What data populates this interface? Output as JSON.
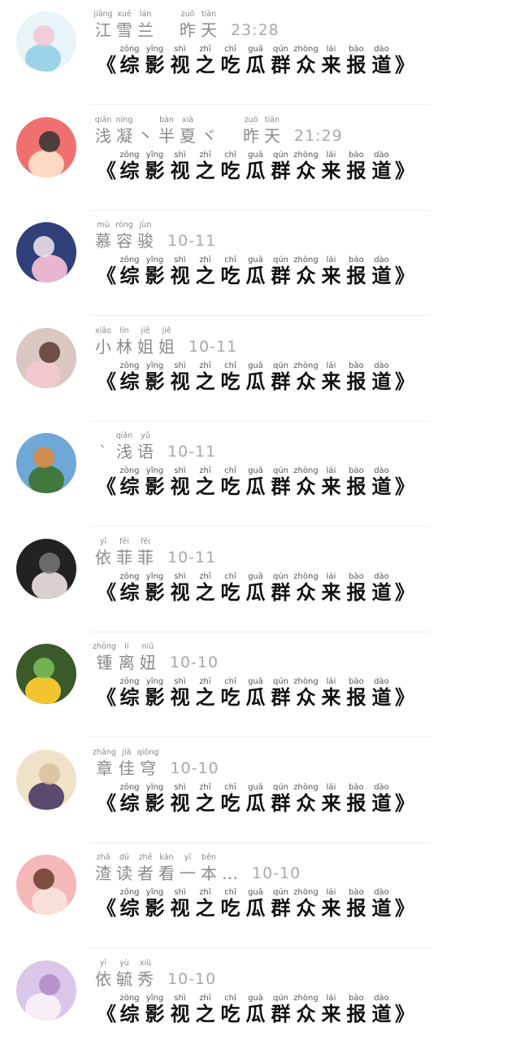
{
  "message": {
    "chars": [
      {
        "hz": "《",
        "py": ""
      },
      {
        "hz": "综",
        "py": "zōng"
      },
      {
        "hz": "影",
        "py": "yǐng"
      },
      {
        "hz": "视",
        "py": "shì"
      },
      {
        "hz": "之",
        "py": "zhī"
      },
      {
        "hz": "吃",
        "py": "chī"
      },
      {
        "hz": "瓜",
        "py": "guā"
      },
      {
        "hz": "群",
        "py": "qún"
      },
      {
        "hz": "众",
        "py": "zhòng"
      },
      {
        "hz": "来",
        "py": "lái"
      },
      {
        "hz": "报",
        "py": "bào"
      },
      {
        "hz": "道",
        "py": "dào"
      },
      {
        "hz": "》",
        "py": ""
      }
    ]
  },
  "contacts": [
    {
      "name": [
        {
          "hz": "江",
          "py": "jiāng"
        },
        {
          "hz": "雪",
          "py": "xuě"
        },
        {
          "hz": "兰",
          "py": "lán"
        },
        {
          "hz": " ",
          "py": ""
        },
        {
          "hz": "昨",
          "py": "zuó"
        },
        {
          "hz": "天",
          "py": "tiān"
        }
      ],
      "time": "23:28",
      "avatar_colors": [
        "#e8f4f8",
        "#9cd3e6",
        "#f2c6d4"
      ]
    },
    {
      "name": [
        {
          "hz": "浅",
          "py": "qiǎn"
        },
        {
          "hz": "凝",
          "py": "níng"
        },
        {
          "hz": "丶",
          "py": ""
        },
        {
          "hz": "半",
          "py": "bàn"
        },
        {
          "hz": "夏",
          "py": "xià"
        },
        {
          "hz": "ヾ",
          "py": ""
        },
        {
          "hz": " ",
          "py": ""
        },
        {
          "hz": "昨",
          "py": "zuó"
        },
        {
          "hz": "天",
          "py": "tiān"
        }
      ],
      "time": "21:29",
      "avatar_colors": [
        "#f07070",
        "#ffd9c2",
        "#333333"
      ]
    },
    {
      "name": [
        {
          "hz": "慕",
          "py": "mù"
        },
        {
          "hz": "容",
          "py": "róng"
        },
        {
          "hz": "骏",
          "py": "jùn"
        }
      ],
      "time": "10-11",
      "avatar_colors": [
        "#30407a",
        "#e8b6cf",
        "#f6e9f0"
      ]
    },
    {
      "name": [
        {
          "hz": "小",
          "py": "xiǎo"
        },
        {
          "hz": "林",
          "py": "lín"
        },
        {
          "hz": "姐",
          "py": "jiě"
        },
        {
          "hz": "姐",
          "py": "jiě"
        }
      ],
      "time": "10-11",
      "avatar_colors": [
        "#d9c7c0",
        "#f0c8cd",
        "#5a3a30"
      ]
    },
    {
      "name": [
        {
          "hz": "`",
          "py": ""
        },
        {
          "hz": "浅",
          "py": "qiǎn"
        },
        {
          "hz": "语",
          "py": "yǔ"
        }
      ],
      "time": "10-11",
      "avatar_colors": [
        "#6fa8d6",
        "#3f7a3c",
        "#e08a3a"
      ]
    },
    {
      "name": [
        {
          "hz": "依",
          "py": "yī"
        },
        {
          "hz": "菲",
          "py": "fēi"
        },
        {
          "hz": "菲",
          "py": "fēi"
        }
      ],
      "time": "10-11",
      "avatar_colors": [
        "#222222",
        "#d8d0cc",
        "#777777"
      ]
    },
    {
      "name": [
        {
          "hz": "锺",
          "py": "zhōng"
        },
        {
          "hz": "离",
          "py": "lí"
        },
        {
          "hz": "妞",
          "py": "niū"
        }
      ],
      "time": "10-10",
      "avatar_colors": [
        "#3a5a2a",
        "#f2c530",
        "#7bbf5a"
      ]
    },
    {
      "name": [
        {
          "hz": "章",
          "py": "zhāng"
        },
        {
          "hz": "佳",
          "py": "jiā"
        },
        {
          "hz": "穹",
          "py": "qióng"
        }
      ],
      "time": "10-10",
      "avatar_colors": [
        "#efe2c8",
        "#5a4a70",
        "#d8c19a"
      ]
    },
    {
      "name": [
        {
          "hz": "渣",
          "py": "zhā"
        },
        {
          "hz": "读",
          "py": "dú"
        },
        {
          "hz": "者",
          "py": "zhě"
        },
        {
          "hz": "看",
          "py": "kàn"
        },
        {
          "hz": "一",
          "py": "yī"
        },
        {
          "hz": "本",
          "py": "běn"
        },
        {
          "hz": "…",
          "py": ""
        }
      ],
      "time": "10-10",
      "avatar_colors": [
        "#f4b8b8",
        "#f8e0d8",
        "#6a3a2a"
      ]
    },
    {
      "name": [
        {
          "hz": "依",
          "py": "yī"
        },
        {
          "hz": "毓",
          "py": "yù"
        },
        {
          "hz": "秀",
          "py": "xiù"
        }
      ],
      "time": "10-10",
      "avatar_colors": [
        "#d9c6e8",
        "#f7eef8",
        "#b08ac8"
      ]
    }
  ]
}
